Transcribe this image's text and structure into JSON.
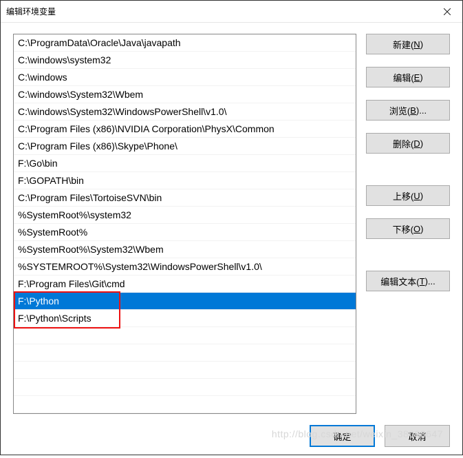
{
  "titlebar": {
    "title": "编辑环境变量"
  },
  "list": {
    "items": [
      {
        "path": "C:\\ProgramData\\Oracle\\Java\\javapath",
        "selected": false
      },
      {
        "path": "C:\\windows\\system32",
        "selected": false
      },
      {
        "path": "C:\\windows",
        "selected": false
      },
      {
        "path": "C:\\windows\\System32\\Wbem",
        "selected": false
      },
      {
        "path": "C:\\windows\\System32\\WindowsPowerShell\\v1.0\\",
        "selected": false
      },
      {
        "path": "C:\\Program Files (x86)\\NVIDIA Corporation\\PhysX\\Common",
        "selected": false
      },
      {
        "path": "C:\\Program Files (x86)\\Skype\\Phone\\",
        "selected": false
      },
      {
        "path": "F:\\Go\\bin",
        "selected": false
      },
      {
        "path": "F:\\GOPATH\\bin",
        "selected": false
      },
      {
        "path": "C:\\Program Files\\TortoiseSVN\\bin",
        "selected": false
      },
      {
        "path": "%SystemRoot%\\system32",
        "selected": false
      },
      {
        "path": "%SystemRoot%",
        "selected": false
      },
      {
        "path": "%SystemRoot%\\System32\\Wbem",
        "selected": false
      },
      {
        "path": "%SYSTEMROOT%\\System32\\WindowsPowerShell\\v1.0\\",
        "selected": false
      },
      {
        "path": "F:\\Program Files\\Git\\cmd",
        "selected": false
      },
      {
        "path": "F:\\Python",
        "selected": true
      },
      {
        "path": "F:\\Python\\Scripts",
        "selected": false
      }
    ],
    "highlightBox": {
      "fromIndex": 15,
      "toIndex": 16
    }
  },
  "buttons": {
    "new": {
      "text": "新建(",
      "accel": "N",
      "tail": ")"
    },
    "edit": {
      "text": "编辑(",
      "accel": "E",
      "tail": ")"
    },
    "browse": {
      "text": "浏览(",
      "accel": "B",
      "tail": ")..."
    },
    "delete": {
      "text": "删除(",
      "accel": "D",
      "tail": ")"
    },
    "moveUp": {
      "text": "上移(",
      "accel": "U",
      "tail": ")"
    },
    "moveDown": {
      "text": "下移(",
      "accel": "O",
      "tail": ")"
    },
    "editText": {
      "text": "编辑文本(",
      "accel": "T",
      "tail": ")..."
    }
  },
  "footer": {
    "ok": "确定",
    "cancel": "取消"
  },
  "watermark": "http://blog.csdn.net/weixin_38098647"
}
